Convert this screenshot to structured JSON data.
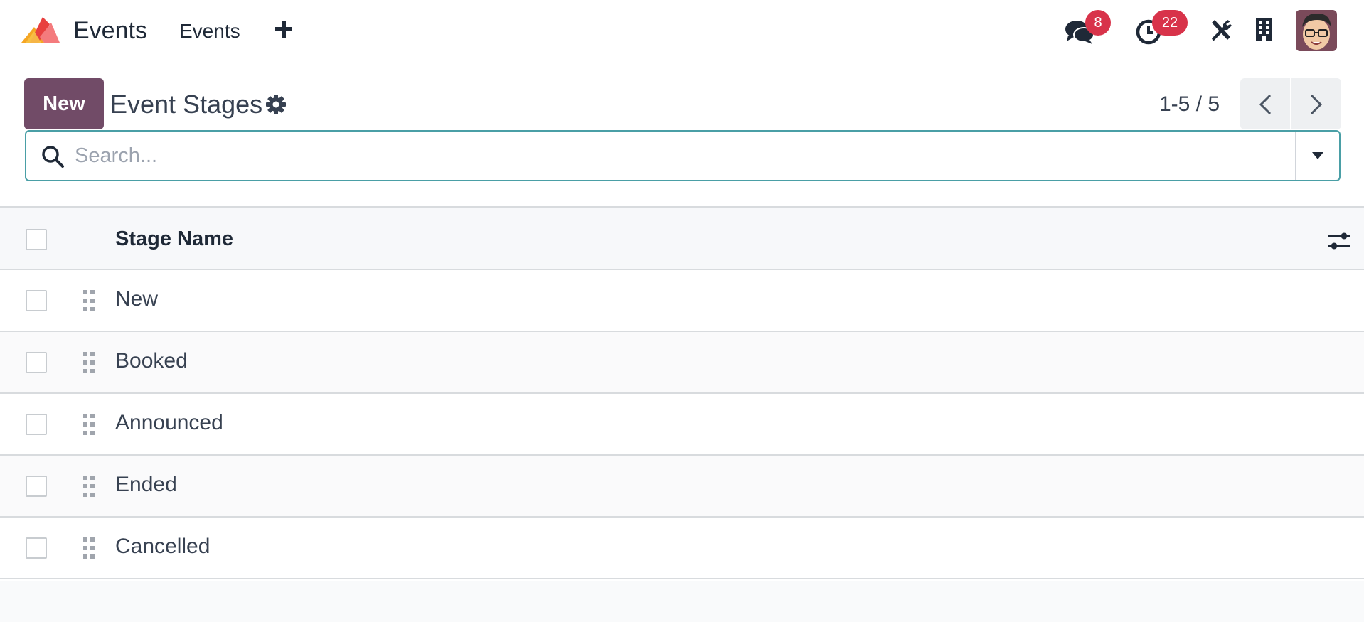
{
  "navbar": {
    "app_name": "Events",
    "menu_item": "Events",
    "messages_count": "8",
    "activities_count": "22"
  },
  "control_panel": {
    "new_label": "New",
    "title": "Event Stages",
    "pager": "1-5 / 5"
  },
  "search": {
    "placeholder": "Search..."
  },
  "table": {
    "column_header": "Stage Name",
    "rows": [
      "New",
      "Booked",
      "Announced",
      "Ended",
      "Cancelled"
    ]
  },
  "colors": {
    "brand": "#714b67",
    "badge": "#d8334a",
    "search_border": "#4a9fa6"
  }
}
